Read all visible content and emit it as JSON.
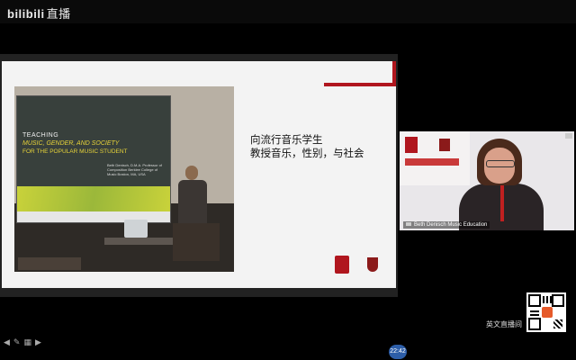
{
  "header": {
    "logo_text": "bilibili",
    "logo_suffix": "直播"
  },
  "slide": {
    "photo_screen": {
      "line1": "TEACHING",
      "line2": "MUSIC, GENDER, AND SOCIETY",
      "line3": "FOR THE POPULAR MUSIC STUDENT",
      "presenter_block": "Beth Denisch, D.M.A. Professor of Composition Berklee College of Music Boston, MA, USA"
    },
    "chinese_title_line1": "向流行音乐学生",
    "chinese_title_line2": "教授音乐，性别，与社会"
  },
  "slide_controls": {
    "prev_icon": "◀",
    "pen_icon": "✎",
    "grid_icon": "▦",
    "next_icon": "▶"
  },
  "camera": {
    "caption": "Beth Denisch Music Education"
  },
  "sidebar": {
    "broadcaster": "英文直播间"
  },
  "timer": {
    "label": "22:42"
  },
  "colors": {
    "accent_red": "#b0161e",
    "timer_blue": "#2d5ea8"
  }
}
